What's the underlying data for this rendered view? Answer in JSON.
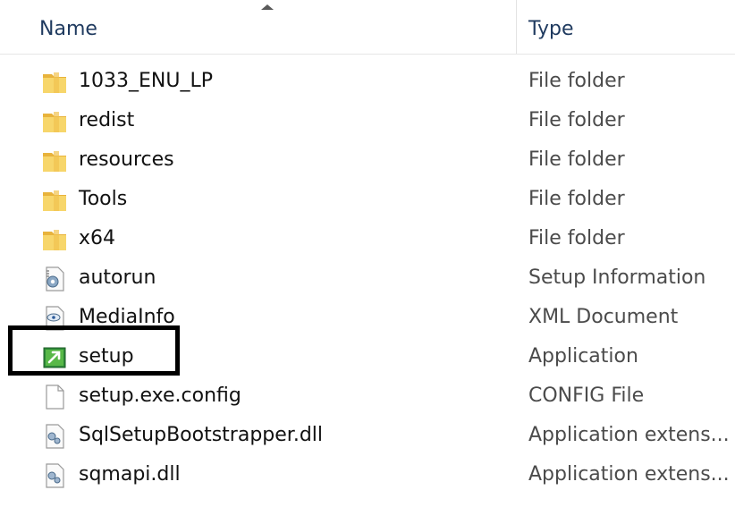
{
  "columns": {
    "name": "Name",
    "type": "Type"
  },
  "files": [
    {
      "name": "1033_ENU_LP",
      "type": "File folder",
      "icon": "folder-icon"
    },
    {
      "name": "redist",
      "type": "File folder",
      "icon": "folder-icon"
    },
    {
      "name": "resources",
      "type": "File folder",
      "icon": "folder-icon"
    },
    {
      "name": "Tools",
      "type": "File folder",
      "icon": "folder-icon"
    },
    {
      "name": "x64",
      "type": "File folder",
      "icon": "folder-icon"
    },
    {
      "name": "autorun",
      "type": "Setup Information",
      "icon": "setup-info-icon"
    },
    {
      "name": "MediaInfo",
      "type": "XML Document",
      "icon": "xml-document-icon"
    },
    {
      "name": "setup",
      "type": "Application",
      "icon": "application-icon"
    },
    {
      "name": "setup.exe.config",
      "type": "CONFIG File",
      "icon": "config-file-icon"
    },
    {
      "name": "SqlSetupBootstrapper.dll",
      "type": "Application extens...",
      "icon": "dll-icon"
    },
    {
      "name": "sqmapi.dll",
      "type": "Application extens...",
      "icon": "dll-icon"
    }
  ],
  "colors": {
    "folder": "#f2c94c",
    "header_text": "#1f3a5f",
    "highlight": "#000000"
  }
}
